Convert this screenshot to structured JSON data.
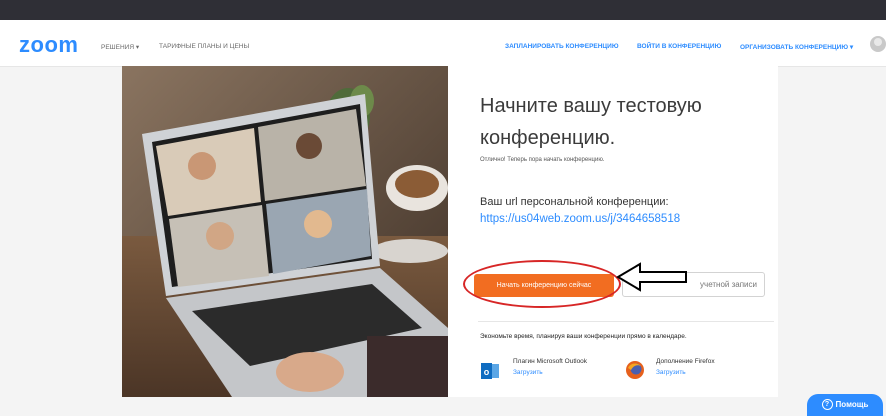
{
  "header": {
    "logo": "zoom",
    "solutions": "РЕШЕНИЯ ▾",
    "plans": "ТАРИФНЫЕ ПЛАНЫ И ЦЕНЫ",
    "schedule": "ЗАПЛАНИРОВАТЬ КОНФЕРЕНЦИЮ",
    "join": "ВОЙТИ В КОНФЕРЕНЦИЮ",
    "host": "ОРГАНИЗОВАТЬ КОНФЕРЕНЦИЮ ▾"
  },
  "main": {
    "title": "Начните вашу тестовую конференцию.",
    "description": "Отлично! Теперь пора начать конференцию.",
    "url_label": "Ваш url персональной конференции:",
    "url": "https://us04web.zoom.us/j/3464658518",
    "start_button": "Начать конференцию сейчас",
    "secondary_button": "учетной записи"
  },
  "calendar": {
    "hint": "Экономьте время, планируя ваши конференции прямо в календаре.",
    "outlook_name": "Плагин Microsoft Outlook",
    "outlook_link": "Загрузить",
    "firefox_name": "Дополнение Firefox",
    "firefox_link": "Загрузить"
  },
  "help": "Помощь",
  "colors": {
    "brand": "#2d8cff",
    "start_button": "#f26d21",
    "annotation_circle": "#d72626"
  },
  "icons": {
    "outlook": "outlook-icon",
    "firefox": "firefox-icon",
    "help": "question-circle-icon",
    "annotation": "arrow-left-icon"
  }
}
